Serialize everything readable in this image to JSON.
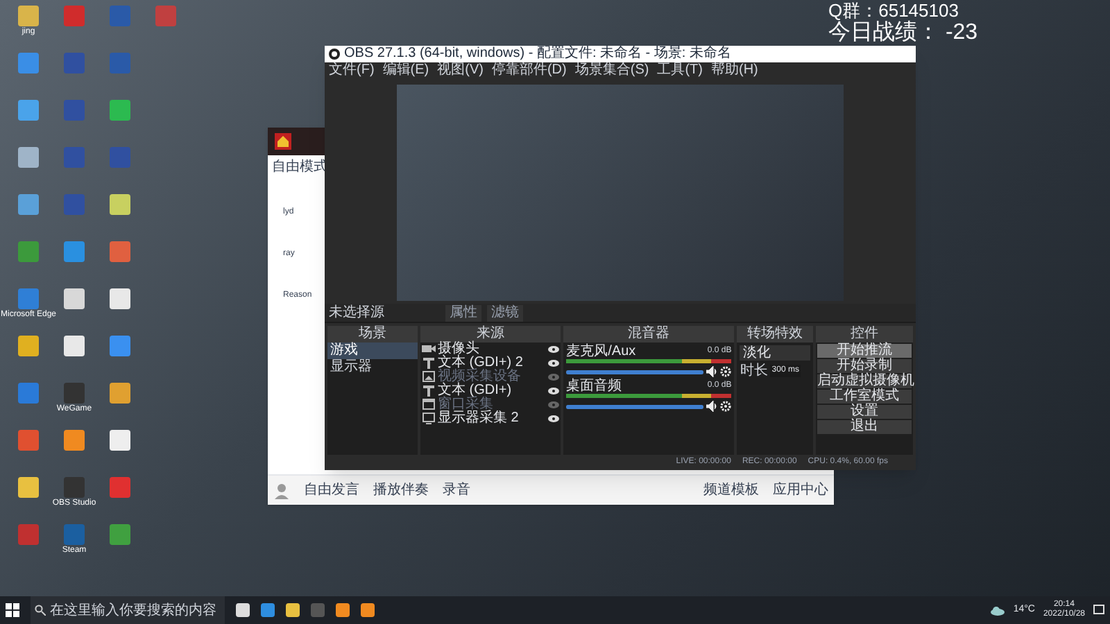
{
  "overlay": {
    "group": "Q群：65145103",
    "score": "今日战绩： -23"
  },
  "desktop_icons": [
    {
      "color": "#d9b44a",
      "label": "jing"
    },
    {
      "color": "#3a8ee6"
    },
    {
      "color": "#4aa3ea"
    },
    {
      "color": "#9fb4c8"
    },
    {
      "color": "#5aa0d8"
    },
    {
      "color": "#3c9a3c"
    },
    {
      "color": "#2f7fd6",
      "label": "Microsoft Edge"
    },
    {
      "color": "#e0b020"
    },
    {
      "color": "#2a7ad8"
    },
    {
      "color": "#e05030"
    },
    {
      "color": "#e8c040"
    },
    {
      "color": "#c03030"
    },
    {
      "color": "#d02c2c"
    },
    {
      "color": "#3050a0"
    },
    {
      "color": "#3050a0"
    },
    {
      "color": "#3050a0"
    },
    {
      "color": "#3050a0"
    },
    {
      "color": "#2a90e0"
    },
    {
      "color": "#d8d8d8"
    },
    {
      "color": "#e8e8e8"
    },
    {
      "color": "#333333",
      "label": "WeGame"
    },
    {
      "color": "#f08a20"
    },
    {
      "color": "#333333",
      "label": "OBS Studio"
    },
    {
      "color": "#1b5fa0",
      "label": "Steam"
    },
    {
      "color": "#2a5aa8"
    },
    {
      "color": "#2a5aa8"
    },
    {
      "color": "#2cba50"
    },
    {
      "color": "#3050a0"
    },
    {
      "color": "#c8d060"
    },
    {
      "color": "#e06040"
    },
    {
      "color": "#e8e8e8"
    },
    {
      "color": "#3a90f0"
    },
    {
      "color": "#e0a030"
    },
    {
      "color": "#eeeeee"
    },
    {
      "color": "#e03030"
    },
    {
      "color": "#40a040"
    },
    {
      "color": "#c04040"
    }
  ],
  "chat": {
    "mode": "自由模式",
    "members": [
      {
        "name": "lyd"
      },
      {
        "name": "ray"
      },
      {
        "name": "Reason"
      }
    ],
    "toolbar": [
      "自由发言",
      "播放伴奏",
      "录音",
      "频道模板",
      "应用中心"
    ]
  },
  "obs": {
    "title": "OBS 27.1.3 (64-bit, windows) - 配置文件: 未命名 - 场景: 未命名",
    "menu": [
      "文件(F)",
      "编辑(E)",
      "视图(V)",
      "停靠部件(D)",
      "场景集合(S)",
      "工具(T)",
      "帮助(H)"
    ],
    "source_bar": {
      "label": "未选择源",
      "buttons": [
        "属性",
        "滤镜"
      ]
    },
    "scenes": {
      "title": "场景",
      "items": [
        {
          "label": "游戏",
          "selected": true
        },
        {
          "label": "显示器",
          "selected": false
        }
      ]
    },
    "sources": {
      "title": "来源",
      "items": [
        {
          "kind": "camera",
          "label": "摄像头",
          "visible": true
        },
        {
          "kind": "text",
          "label": "文本 (GDI+) 2",
          "visible": true
        },
        {
          "kind": "image",
          "label": "视频采集设备",
          "visible": false
        },
        {
          "kind": "text",
          "label": "文本 (GDI+)",
          "visible": true
        },
        {
          "kind": "window",
          "label": "窗口采集",
          "visible": false
        },
        {
          "kind": "display",
          "label": "显示器采集 2",
          "visible": true
        }
      ]
    },
    "mixer": {
      "title": "混音器",
      "channels": [
        {
          "name": "麦克风/Aux",
          "reading": "0.0 dB",
          "level": 1.0
        },
        {
          "name": "桌面音频",
          "reading": "0.0 dB",
          "level": 1.0
        }
      ]
    },
    "transitions": {
      "title": "转场特效",
      "type": "淡化",
      "duration_label": "时长",
      "duration": "300 ms"
    },
    "controls": {
      "title": "控件",
      "buttons": [
        {
          "label": "开始推流",
          "hovered": true
        },
        {
          "label": "开始录制",
          "hovered": false
        },
        {
          "label": "启动虚拟摄像机",
          "hovered": false
        },
        {
          "label": "工作室模式",
          "hovered": false
        },
        {
          "label": "设置",
          "hovered": false
        },
        {
          "label": "退出",
          "hovered": false
        }
      ]
    },
    "status": {
      "live": "LIVE: 00:00:00",
      "rec": "REC: 00:00:00",
      "cpu": "CPU: 0.4%, 60.00 fps"
    }
  },
  "taskbar": {
    "search_placeholder": "在这里输入你要搜索的内容",
    "weather": "14°C",
    "time": "20:14",
    "date": "2022/10/28"
  }
}
